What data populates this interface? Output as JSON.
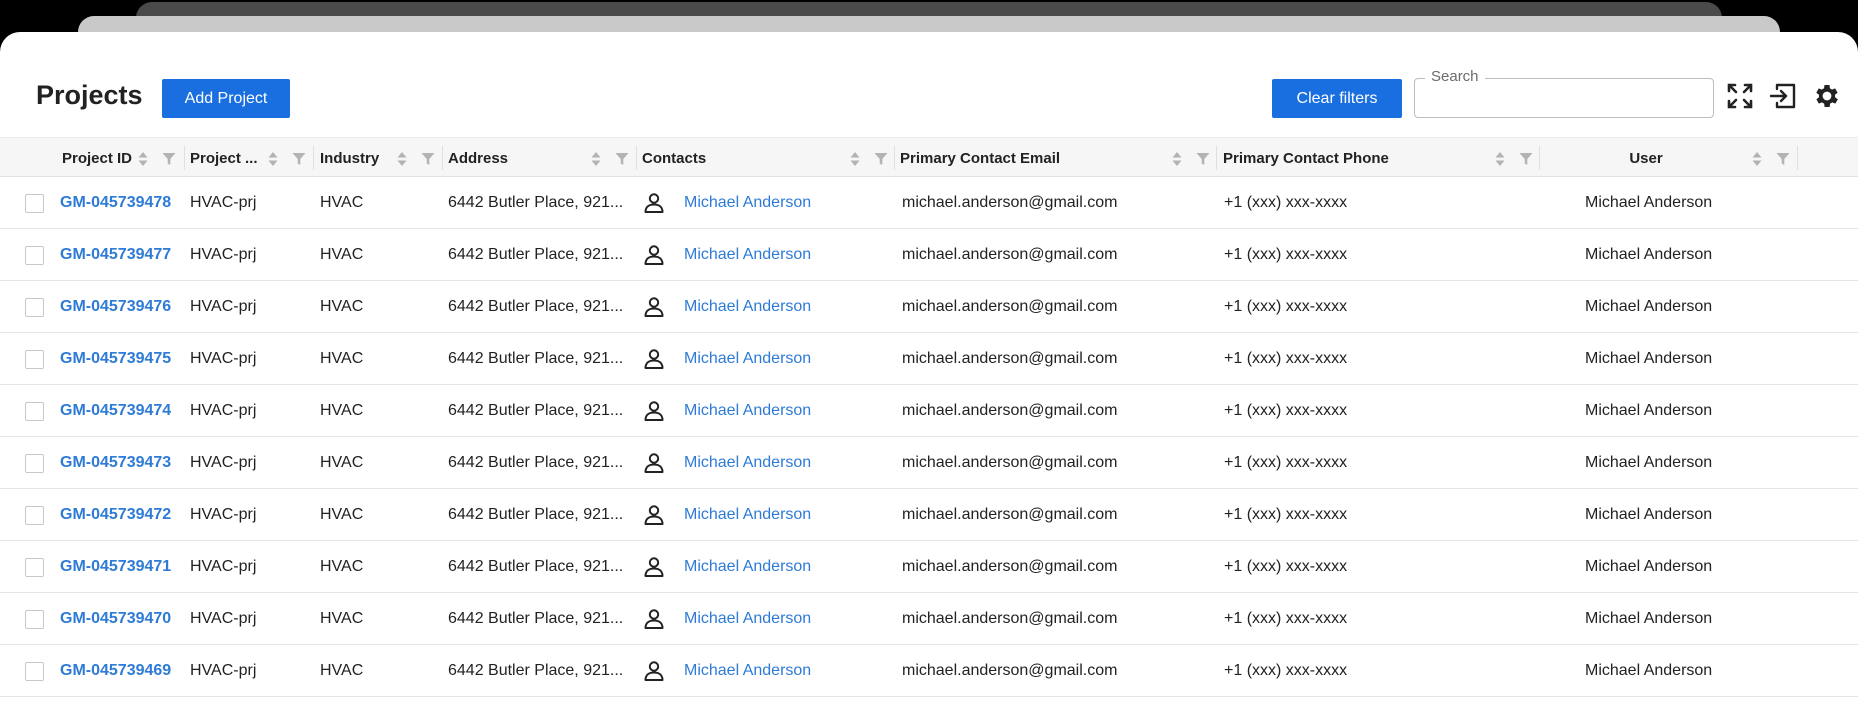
{
  "page": {
    "title": "Projects"
  },
  "toolbar": {
    "add_label": "Add Project",
    "clear_label": "Clear filters",
    "search_label": "Search",
    "search_value": "",
    "icons": [
      "fullscreen-icon",
      "exit-icon",
      "gear-icon"
    ]
  },
  "colors": {
    "accent": "#1a6fe0",
    "link": "#2d7bd6"
  },
  "table": {
    "columns": [
      {
        "label": "Project ID"
      },
      {
        "label": "Project ..."
      },
      {
        "label": "Industry"
      },
      {
        "label": "Address"
      },
      {
        "label": "Contacts"
      },
      {
        "label": "Primary Contact Email"
      },
      {
        "label": "Primary Contact Phone"
      },
      {
        "label": "User"
      }
    ],
    "rows": [
      {
        "id": "GM-045739478",
        "name": "HVAC-prj",
        "industry": "HVAC",
        "address": "6442 Butler Place, 921...",
        "contact": "Michael Anderson",
        "email": "michael.anderson@gmail.com",
        "phone": "+1 (xxx) xxx-xxxx",
        "user": "Michael Anderson"
      },
      {
        "id": "GM-045739477",
        "name": "HVAC-prj",
        "industry": "HVAC",
        "address": "6442 Butler Place, 921...",
        "contact": "Michael Anderson",
        "email": "michael.anderson@gmail.com",
        "phone": "+1 (xxx) xxx-xxxx",
        "user": "Michael Anderson"
      },
      {
        "id": "GM-045739476",
        "name": "HVAC-prj",
        "industry": "HVAC",
        "address": "6442 Butler Place, 921...",
        "contact": "Michael Anderson",
        "email": "michael.anderson@gmail.com",
        "phone": "+1 (xxx) xxx-xxxx",
        "user": "Michael Anderson"
      },
      {
        "id": "GM-045739475",
        "name": "HVAC-prj",
        "industry": "HVAC",
        "address": "6442 Butler Place, 921...",
        "contact": "Michael Anderson",
        "email": "michael.anderson@gmail.com",
        "phone": "+1 (xxx) xxx-xxxx",
        "user": "Michael Anderson"
      },
      {
        "id": "GM-045739474",
        "name": "HVAC-prj",
        "industry": "HVAC",
        "address": "6442 Butler Place, 921...",
        "contact": "Michael Anderson",
        "email": "michael.anderson@gmail.com",
        "phone": "+1 (xxx) xxx-xxxx",
        "user": "Michael Anderson"
      },
      {
        "id": "GM-045739473",
        "name": "HVAC-prj",
        "industry": "HVAC",
        "address": "6442 Butler Place, 921...",
        "contact": "Michael Anderson",
        "email": "michael.anderson@gmail.com",
        "phone": "+1 (xxx) xxx-xxxx",
        "user": "Michael Anderson"
      },
      {
        "id": "GM-045739472",
        "name": "HVAC-prj",
        "industry": "HVAC",
        "address": "6442 Butler Place, 921...",
        "contact": "Michael Anderson",
        "email": "michael.anderson@gmail.com",
        "phone": "+1 (xxx) xxx-xxxx",
        "user": "Michael Anderson"
      },
      {
        "id": "GM-045739471",
        "name": "HVAC-prj",
        "industry": "HVAC",
        "address": "6442 Butler Place, 921...",
        "contact": "Michael Anderson",
        "email": "michael.anderson@gmail.com",
        "phone": "+1 (xxx) xxx-xxxx",
        "user": "Michael Anderson"
      },
      {
        "id": "GM-045739470",
        "name": "HVAC-prj",
        "industry": "HVAC",
        "address": "6442 Butler Place, 921...",
        "contact": "Michael Anderson",
        "email": "michael.anderson@gmail.com",
        "phone": "+1 (xxx) xxx-xxxx",
        "user": "Michael Anderson"
      },
      {
        "id": "GM-045739469",
        "name": "HVAC-prj",
        "industry": "HVAC",
        "address": "6442 Butler Place, 921...",
        "contact": "Michael Anderson",
        "email": "michael.anderson@gmail.com",
        "phone": "+1 (xxx) xxx-xxxx",
        "user": "Michael Anderson"
      }
    ]
  }
}
